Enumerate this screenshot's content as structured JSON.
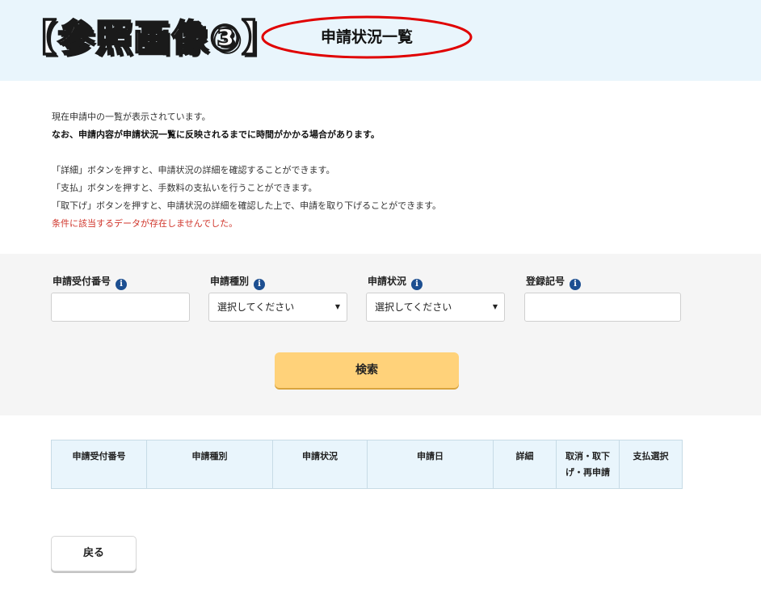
{
  "header": {
    "reference_title": "【参照画像③】",
    "page_heading": "申請状況一覧",
    "highlight_color": "#e00000",
    "banner_color": "#e9f5fc"
  },
  "description": {
    "line1": "現在申請中の一覧が表示されています。",
    "line2": "なお、申請内容が申請状況一覧に反映されるまでに時間がかかる場合があります。",
    "line3": "「詳細」ボタンを押すと、申請状況の詳細を確認することができます。",
    "line4": "「支払」ボタンを押すと、手数料の支払いを行うことができます。",
    "line5": "「取下げ」ボタンを押すと、申請状況の詳細を確認した上で、申請を取り下げることができます。",
    "notice": "条件に該当するデータが存在しませんでした。",
    "notice_color": "#d0352b"
  },
  "search": {
    "fields": {
      "receipt_number": {
        "label": "申請受付番号",
        "value": ""
      },
      "application_type": {
        "label": "申請種別",
        "selected": "選択してください"
      },
      "application_status": {
        "label": "申請状況",
        "selected": "選択してください"
      },
      "registration_number": {
        "label": "登録記号",
        "value": ""
      }
    },
    "info_icon": "i",
    "search_button_label": "検索",
    "search_button_color": "#ffd27a"
  },
  "results": {
    "columns": [
      "申請受付番号",
      "申請種別",
      "申請状況",
      "申請日",
      "詳細",
      "取消・取下げ・再申請",
      "支払選択"
    ],
    "rows": []
  },
  "footer": {
    "back_button_label": "戻る"
  }
}
